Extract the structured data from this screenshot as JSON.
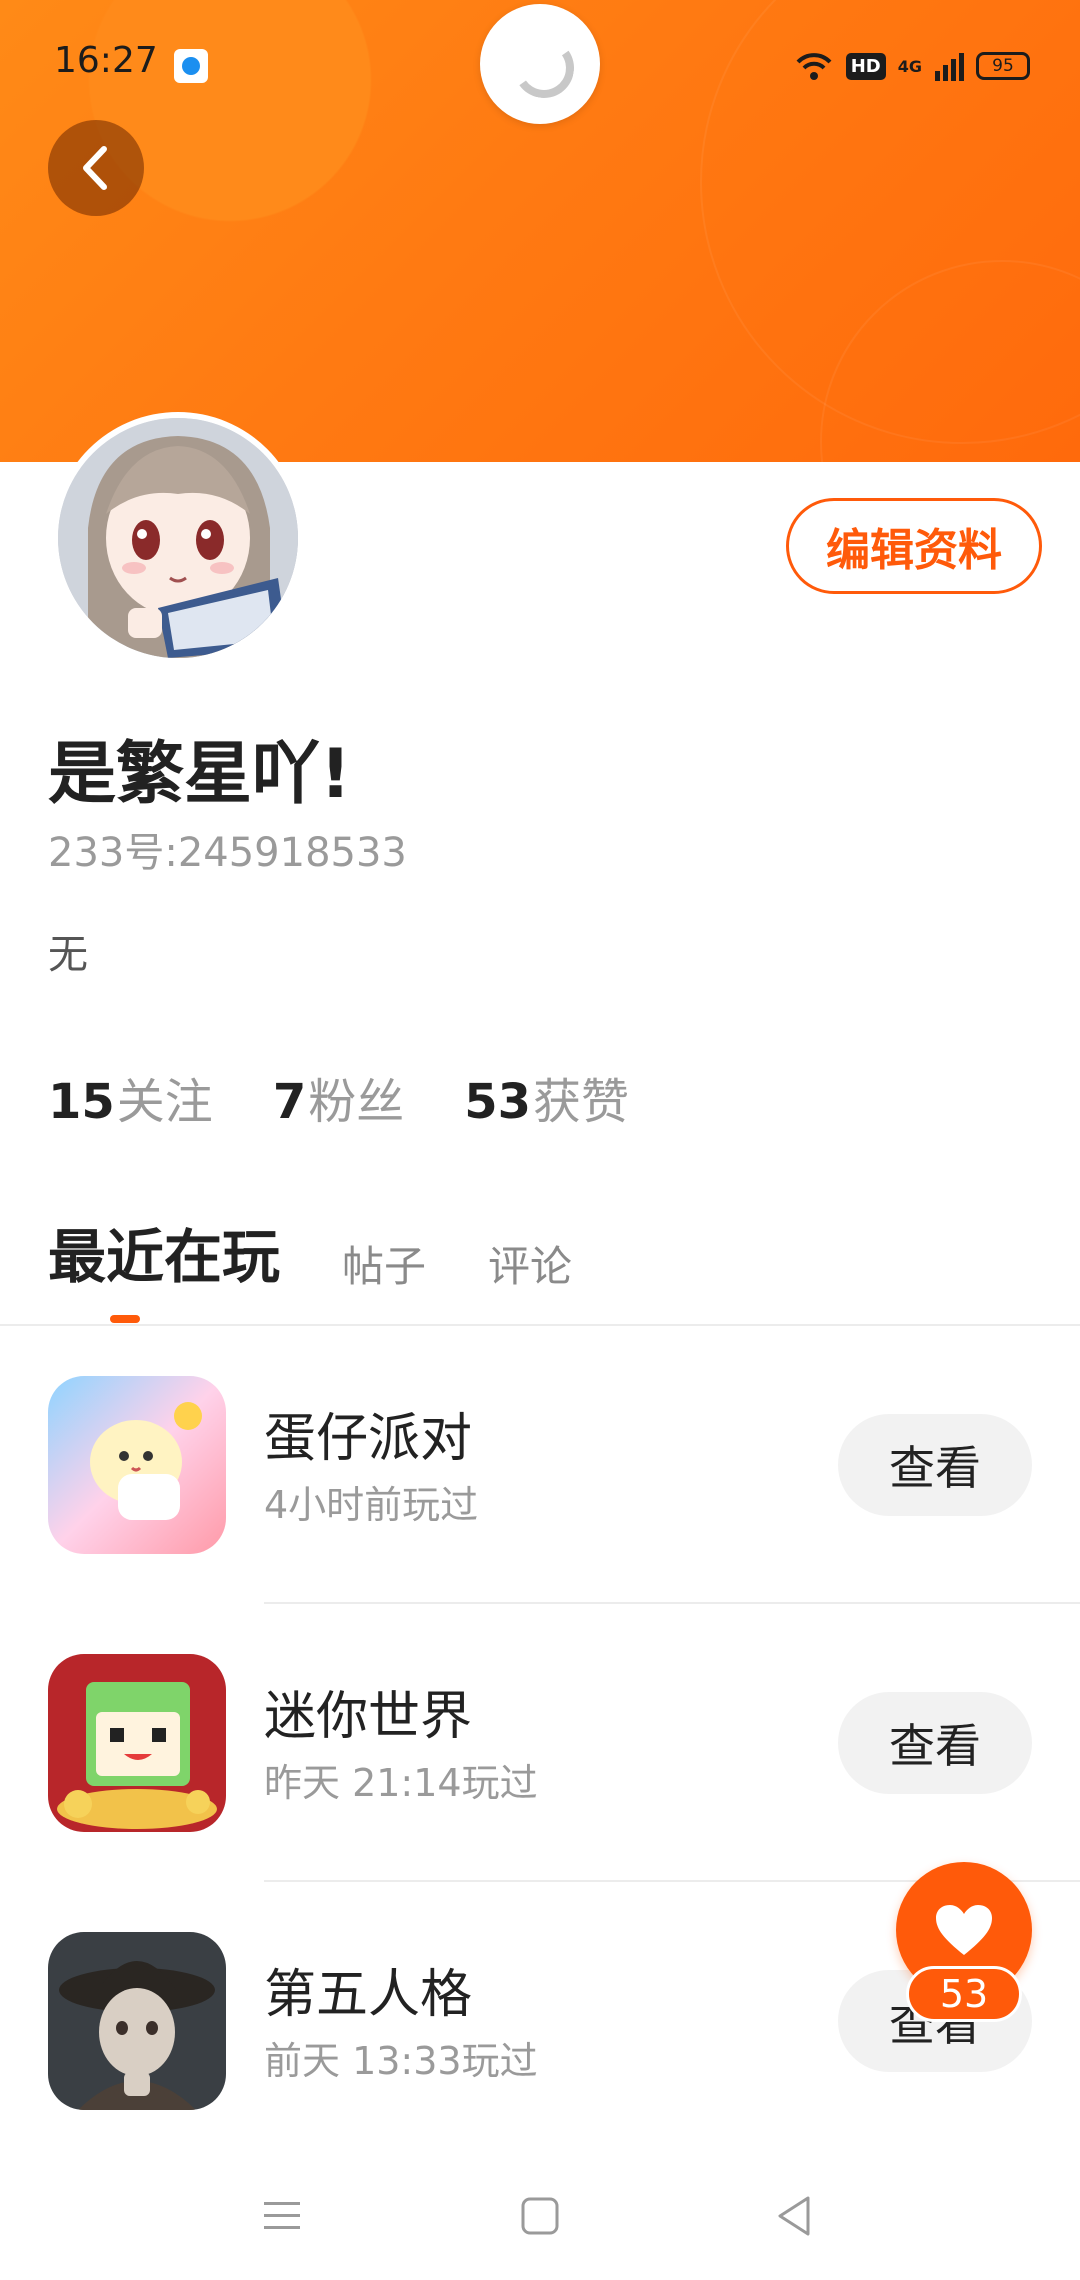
{
  "status_bar": {
    "time": "16:27",
    "hd": "HD",
    "network": "4G",
    "battery": "95"
  },
  "profile": {
    "edit_label": "编辑资料",
    "username": "是繁星吖!",
    "id_text": "233号:245918533",
    "bio": "无",
    "stats": [
      {
        "num": "15",
        "label": "关注"
      },
      {
        "num": "7",
        "label": "粉丝"
      },
      {
        "num": "53",
        "label": "获赞"
      }
    ]
  },
  "tabs": [
    {
      "label": "最近在玩",
      "active": true
    },
    {
      "label": "帖子",
      "active": false
    },
    {
      "label": "评论",
      "active": false
    }
  ],
  "games": [
    {
      "name": "蛋仔派对",
      "played": "4小时前玩过",
      "button": "查看"
    },
    {
      "name": "迷你世界",
      "played": "昨天 21:14玩过",
      "button": "查看"
    },
    {
      "name": "第五人格",
      "played": "前天 13:33玩过",
      "button": "查看"
    }
  ],
  "fab": {
    "count": "53"
  },
  "colors": {
    "accent": "#ff5a0a",
    "header": "#ff7a12"
  }
}
